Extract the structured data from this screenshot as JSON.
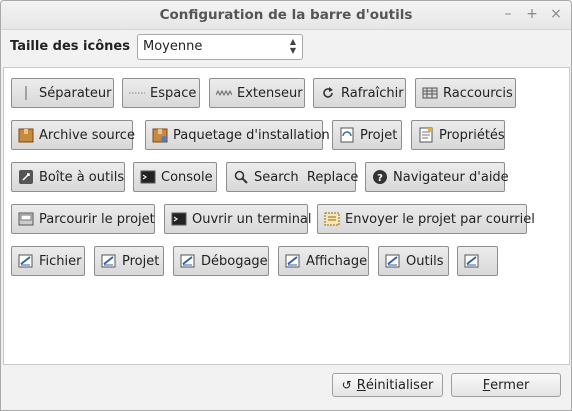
{
  "window": {
    "title": "Configuration de la barre d'outils",
    "controls": [
      "–",
      "+",
      "×"
    ]
  },
  "icon_size": {
    "label": "Taille des icônes",
    "selected": "Moyenne"
  },
  "toolbar_items": [
    {
      "label": "Séparateur",
      "icon": "separator-icon"
    },
    {
      "label": "Espace",
      "icon": "space-icon"
    },
    {
      "label": "Extenseur",
      "icon": "expander-icon"
    },
    {
      "label": "Rafraîchir",
      "icon": "refresh-icon"
    },
    {
      "label": "Raccourcis",
      "icon": "shortcuts-icon"
    },
    {
      "label": "Archive source",
      "icon": "archive-icon"
    },
    {
      "label": "Paquetage d'installation",
      "icon": "package-icon"
    },
    {
      "label": "Projet",
      "icon": "project-icon"
    },
    {
      "label": "Propriétés",
      "icon": "properties-icon"
    },
    {
      "label": "Boîte à outils",
      "icon": "toolbox-icon"
    },
    {
      "label": "Console",
      "icon": "console-icon"
    },
    {
      "label": "Search  Replace",
      "icon": "search-icon"
    },
    {
      "label": "Navigateur d'aide",
      "icon": "help-icon"
    },
    {
      "label": "Parcourir le projet",
      "icon": "browse-icon"
    },
    {
      "label": "Ouvrir un terminal",
      "icon": "terminal-icon"
    },
    {
      "label": "Envoyer le projet par courriel",
      "icon": "mail-icon"
    },
    {
      "label": "Fichier",
      "icon": "menu-icon"
    },
    {
      "label": "Projet",
      "icon": "menu-icon"
    },
    {
      "label": "Débogage",
      "icon": "menu-icon"
    },
    {
      "label": "Affichage",
      "icon": "menu-icon"
    },
    {
      "label": "Outils",
      "icon": "menu-icon"
    },
    {
      "label": "",
      "icon": "menu-icon"
    }
  ],
  "footer": {
    "reset_mnemonic": "R",
    "reset_rest": "éinitialiser",
    "reset_icon": "undo-icon",
    "close_mnemonic": "F",
    "close_rest": "ermer"
  }
}
